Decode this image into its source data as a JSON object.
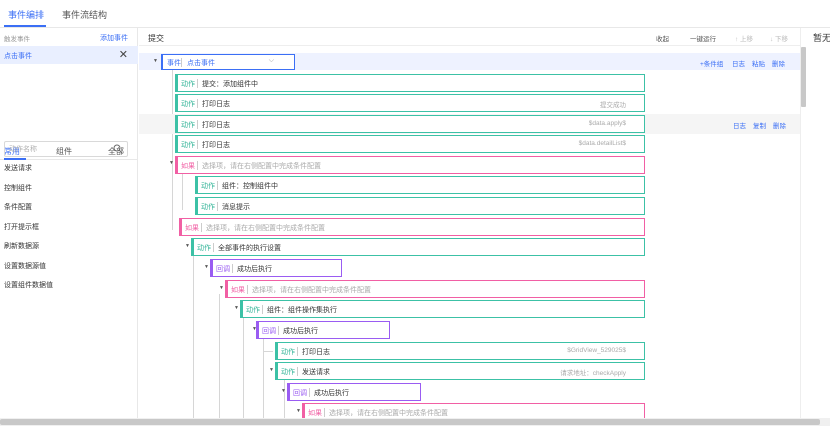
{
  "top_tabs": [
    "事件编排",
    "事件流结构"
  ],
  "left": {
    "events_title": "触发事件",
    "add_event": "添加事件",
    "selected_event": "点击事件",
    "close": "✕",
    "categories": [
      "常用",
      "组件",
      "全部"
    ],
    "search_placeholder": "动作名称",
    "actions": [
      "发送请求",
      "控制组件",
      "条件配置",
      "打开提示框",
      "刷新数据源",
      "设置数据源值",
      "设置组件数据值"
    ]
  },
  "header": {
    "title": "提交",
    "collapse": "收起",
    "run": "一键运行",
    "up": "↑ 上移",
    "down": "↓ 下移"
  },
  "event_row": {
    "tag": "事件",
    "value": "点击事件",
    "links": [
      "+条件组",
      "日志",
      "粘贴",
      "删除"
    ]
  },
  "nodes": [
    {
      "tag": "动作",
      "text": "提交：添加组件中",
      "right": ""
    },
    {
      "tag": "动作",
      "text": "打印日志",
      "right": "提交成功"
    },
    {
      "tag": "动作",
      "text": "打印日志",
      "right": "$data.apply$"
    },
    {
      "tag": "动作",
      "text": "打印日志",
      "right": "$data.detailList$"
    },
    {
      "tag": "如果",
      "text": "选择项，请在右侧配置中完成条件配置",
      "right": ""
    },
    {
      "tag": "动作",
      "text": "组件：控制组件中",
      "right": ""
    },
    {
      "tag": "动作",
      "text": "消息提示",
      "right": ""
    },
    {
      "tag": "如果",
      "text": "选择项，请在右侧配置中完成条件配置",
      "right": ""
    },
    {
      "tag": "动作",
      "text": "全部事件的执行设置",
      "right": ""
    },
    {
      "tag": "回调",
      "text": "成功后执行",
      "right": ""
    },
    {
      "tag": "如果",
      "text": "选择项，请在右侧配置中完成条件配置",
      "right": ""
    },
    {
      "tag": "动作",
      "text": "组件：组件操作集执行",
      "right": ""
    },
    {
      "tag": "回调",
      "text": "成功后执行",
      "right": ""
    },
    {
      "tag": "动作",
      "text": "打印日志",
      "right": "$GridView_529025$"
    },
    {
      "tag": "动作",
      "text": "发送请求",
      "right": "请求地址：checkApply"
    },
    {
      "tag": "回调",
      "text": "成功后执行",
      "right": ""
    },
    {
      "tag": "如果",
      "text": "选择项，请在右侧配置中完成条件配置",
      "right": ""
    }
  ],
  "row_links": [
    "日志",
    "复制",
    "删除"
  ],
  "right_panel_title": "暂无",
  "icons": {
    "search": "search-icon",
    "collapse": "caret-down-icon"
  }
}
